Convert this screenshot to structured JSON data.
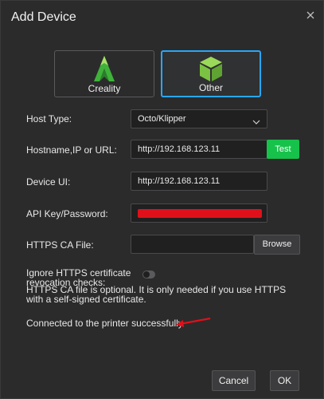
{
  "dialog": {
    "title": "Add Device",
    "close_icon": "close-icon"
  },
  "device_types": [
    {
      "label": "Creality",
      "icon": "creality-logo-icon",
      "selected": false
    },
    {
      "label": "Other",
      "icon": "cube-icon",
      "selected": true
    }
  ],
  "form": {
    "host_type": {
      "label": "Host Type:",
      "value": "Octo/Klipper"
    },
    "hostname": {
      "label": "Hostname,IP or URL:",
      "value": "http://192.168.123.11",
      "button": "Test"
    },
    "device_ui": {
      "label": "Device UI:",
      "value": "http://192.168.123.11"
    },
    "api_key": {
      "label": "API Key/Password:"
    },
    "https_ca": {
      "label": "HTTPS CA File:",
      "value": "",
      "button": "Browse"
    },
    "ignore_revocation": {
      "label": "Ignore HTTPS certificate revocation checks:",
      "enabled": false
    },
    "note": "HTTPS CA file is optional. It is only needed if you use HTTPS with a self-signed certificate."
  },
  "status": "Connected to the printer successfully",
  "footer": {
    "cancel_label": "Cancel",
    "ok_label": "OK"
  },
  "colors": {
    "accent": "#2aa6f5",
    "test_button": "#17c24b",
    "redaction": "#e0101a",
    "annotation_arrow": "#e0101a",
    "creality_green": "#3fb23a",
    "cube_green": "#7cc242"
  }
}
